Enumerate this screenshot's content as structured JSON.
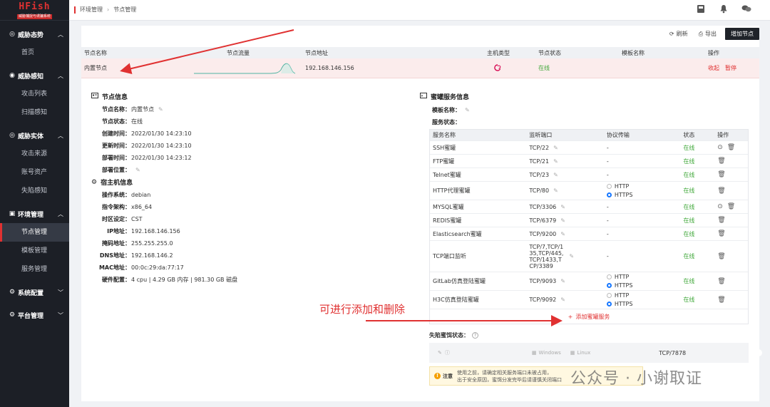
{
  "app": {
    "name": "HFish",
    "subtitle": "威胁捕捉与诱骗系统"
  },
  "sidebar": {
    "groups": [
      {
        "label": "威胁态势",
        "icon": "dashboard-icon",
        "items": [
          "首页"
        ]
      },
      {
        "label": "威胁感知",
        "icon": "radar-icon",
        "items": [
          "攻击列表",
          "扫描感知"
        ]
      },
      {
        "label": "威胁实体",
        "icon": "target-icon",
        "items": [
          "攻击来源",
          "账号资产",
          "失陷感知"
        ]
      },
      {
        "label": "环境管理",
        "icon": "server-icon",
        "items": [
          "节点管理",
          "模板管理",
          "服务管理"
        ]
      },
      {
        "label": "系统配置",
        "icon": "gear-icon",
        "items": []
      },
      {
        "label": "平台管理",
        "icon": "settings-icon",
        "items": []
      }
    ],
    "active": "节点管理"
  },
  "breadcrumb": {
    "parent": "环境管理",
    "sep": "›",
    "current": "节点管理"
  },
  "toolbar": {
    "refresh": "刷新",
    "export": "导出",
    "add_node": "增加节点"
  },
  "node_table": {
    "headers": [
      "节点名称",
      "节点流量",
      "节点地址",
      "主机类型",
      "节点状态",
      "模板名称",
      "操作"
    ],
    "row": {
      "name": "内置节点",
      "address": "192.168.146.156",
      "status": "在线",
      "template": "",
      "action_reclaim": "收起",
      "action_pause": "暂停"
    }
  },
  "node_info": {
    "title": "节点信息",
    "fields": [
      {
        "k": "节点名称：",
        "v": "内置节点",
        "edit": true
      },
      {
        "k": "节点状态：",
        "v": "在线"
      },
      {
        "k": "创建时间：",
        "v": "2022/01/30 14:23:10"
      },
      {
        "k": "更新时间：",
        "v": "2022/01/30 14:23:10"
      },
      {
        "k": "部署时间：",
        "v": "2022/01/30 14:23:12"
      },
      {
        "k": "部署位置：",
        "v": "",
        "edit": true
      }
    ]
  },
  "host_info": {
    "title": "宿主机信息",
    "fields": [
      {
        "k": "操作系统：",
        "v": "debian"
      },
      {
        "k": "指令架构：",
        "v": "x86_64"
      },
      {
        "k": "时区设定：",
        "v": "CST"
      },
      {
        "k": "IP地址：",
        "v": "192.168.146.156"
      },
      {
        "k": "掩码地址：",
        "v": "255.255.255.0"
      },
      {
        "k": "DNS地址：",
        "v": "192.168.146.2"
      },
      {
        "k": "MAC地址：",
        "v": "00:0c:29:da:77:17"
      },
      {
        "k": "硬件配置：",
        "v": "4 cpu | 4.29 GB 内存 | 981.30 GB 磁盘"
      }
    ]
  },
  "honeypot": {
    "title": "蜜罐服务信息",
    "template_label": "模板名称：",
    "status_label": "服务状态：",
    "headers": [
      "服务名称",
      "监听端口",
      "协议传输",
      "状态",
      "操作"
    ],
    "rows": [
      {
        "name": "SSH蜜罐",
        "port": "TCP/22",
        "proto": "-",
        "status": "在线",
        "extra": true
      },
      {
        "name": "FTP蜜罐",
        "port": "TCP/21",
        "proto": "-",
        "status": "在线"
      },
      {
        "name": "Telnet蜜罐",
        "port": "TCP/23",
        "proto": "-",
        "status": "在线"
      },
      {
        "name": "HTTP代理蜜罐",
        "port": "TCP/80",
        "proto": "radio",
        "status": "在线"
      },
      {
        "name": "MYSQL蜜罐",
        "port": "TCP/3306",
        "proto": "-",
        "status": "在线",
        "extra": true
      },
      {
        "name": "REDIS蜜罐",
        "port": "TCP/6379",
        "proto": "-",
        "status": "在线"
      },
      {
        "name": "Elasticsearch蜜罐",
        "port": "TCP/9200",
        "proto": "-",
        "status": "在线"
      },
      {
        "name": "TCP端口监听",
        "port": "TCP/7,TCP/135,TCP/445,TCP/1433,TCP/3389",
        "proto": "-",
        "status": "在线"
      },
      {
        "name": "GitLab仿真登陆蜜罐",
        "port": "TCP/9093",
        "proto": "radio",
        "status": "在线"
      },
      {
        "name": "H3C仿真登陆蜜罐",
        "port": "TCP/9092",
        "proto": "radio",
        "status": "在线"
      }
    ],
    "radio_http": "HTTP",
    "radio_https": "HTTPS",
    "add_service": "添加蜜罐服务"
  },
  "lure": {
    "label": "失陷蜜饵状态：",
    "windows": "Windows",
    "linux": "Linux",
    "port": "TCP/7878"
  },
  "notice": {
    "label": "注意",
    "line1": "使用之前，请确定相关服务端口未被占用，",
    "line2": "出于安全原因，蜜饵分发完毕后请谨慎关闭端口"
  },
  "annotation": "可进行添加和删除",
  "watermark": "公众号 · 小谢取证",
  "colors": {
    "accent": "#e03131",
    "online": "#40a83a",
    "sidebar": "#1c1f26"
  }
}
